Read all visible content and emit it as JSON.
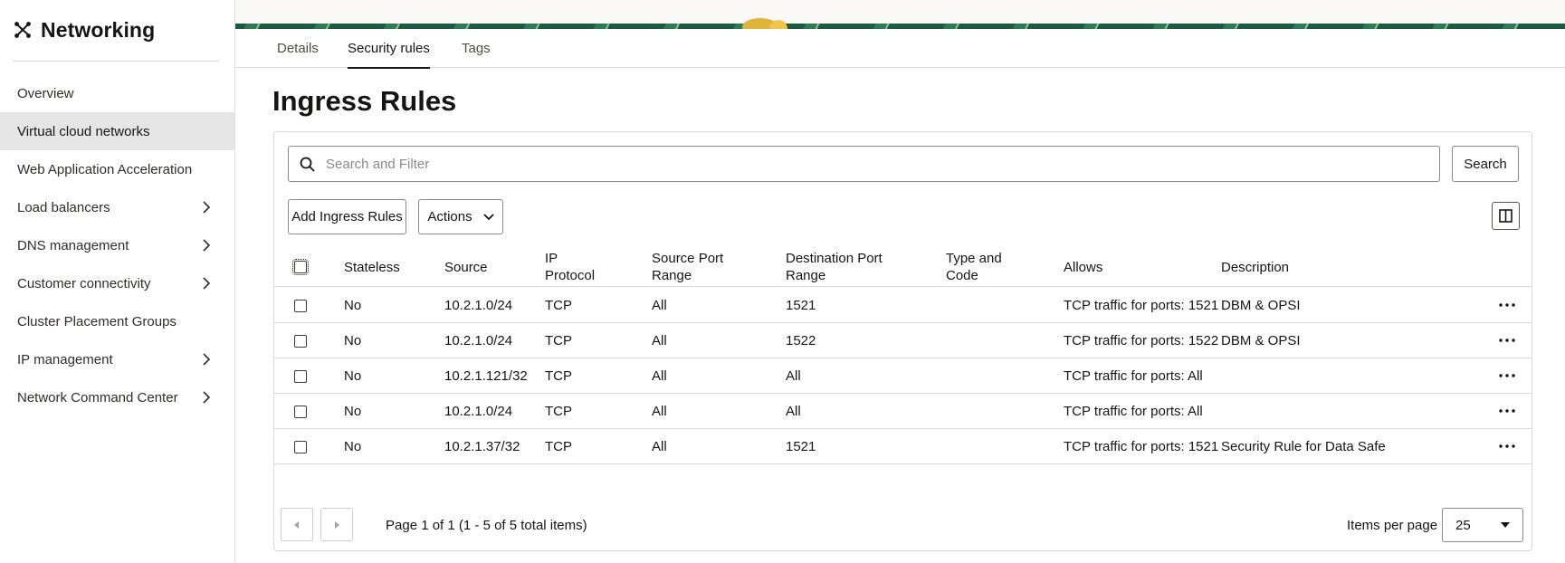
{
  "sidebar": {
    "title": "Networking",
    "items": [
      {
        "label": "Overview",
        "has_submenu": false,
        "active": false
      },
      {
        "label": "Virtual cloud networks",
        "has_submenu": false,
        "active": true
      },
      {
        "label": "Web Application Acceleration",
        "has_submenu": false,
        "active": false
      },
      {
        "label": "Load balancers",
        "has_submenu": true,
        "active": false
      },
      {
        "label": "DNS management",
        "has_submenu": true,
        "active": false
      },
      {
        "label": "Customer connectivity",
        "has_submenu": true,
        "active": false
      },
      {
        "label": "Cluster Placement Groups",
        "has_submenu": false,
        "active": false
      },
      {
        "label": "IP management",
        "has_submenu": true,
        "active": false
      },
      {
        "label": "Network Command Center",
        "has_submenu": true,
        "active": false
      }
    ]
  },
  "tabs": [
    {
      "label": "Details",
      "active": false
    },
    {
      "label": "Security rules",
      "active": true
    },
    {
      "label": "Tags",
      "active": false
    }
  ],
  "page_title": "Ingress Rules",
  "search": {
    "placeholder": "Search and Filter",
    "value": "",
    "button_label": "Search"
  },
  "toolbar": {
    "add_label": "Add Ingress Rules",
    "actions_label": "Actions"
  },
  "table": {
    "columns": [
      "Stateless",
      "Source",
      "IP Protocol",
      "Source Port Range",
      "Destination Port Range",
      "Type and Code",
      "Allows",
      "Description"
    ],
    "header_lines": [
      [
        "Stateless"
      ],
      [
        "Source"
      ],
      [
        "IP",
        "Protocol"
      ],
      [
        "Source Port",
        "Range"
      ],
      [
        "Destination Port",
        "Range"
      ],
      [
        "Type and",
        "Code"
      ],
      [
        "Allows"
      ],
      [
        "Description"
      ]
    ],
    "rows": [
      {
        "stateless": "No",
        "source": "10.2.1.0/24",
        "protocol": "TCP",
        "src_port": "All",
        "dst_port": "1521",
        "type_code": "",
        "allows": "TCP traffic for ports: 1521",
        "description": "DBM & OPSI"
      },
      {
        "stateless": "No",
        "source": "10.2.1.0/24",
        "protocol": "TCP",
        "src_port": "All",
        "dst_port": "1522",
        "type_code": "",
        "allows": "TCP traffic for ports: 1522",
        "description": "DBM & OPSI"
      },
      {
        "stateless": "No",
        "source": "10.2.1.121/32",
        "protocol": "TCP",
        "src_port": "All",
        "dst_port": "All",
        "type_code": "",
        "allows": "TCP traffic for ports: All",
        "description": ""
      },
      {
        "stateless": "No",
        "source": "10.2.1.0/24",
        "protocol": "TCP",
        "src_port": "All",
        "dst_port": "All",
        "type_code": "",
        "allows": "TCP traffic for ports: All",
        "description": ""
      },
      {
        "stateless": "No",
        "source": "10.2.1.37/32",
        "protocol": "TCP",
        "src_port": "All",
        "dst_port": "1521",
        "type_code": "",
        "allows": "TCP traffic for ports: 1521",
        "description": "Security Rule for Data Safe"
      }
    ]
  },
  "pagination": {
    "summary": "Page 1 of 1 (1 - 5 of 5 total items)",
    "items_per_page_label": "Items per page",
    "items_per_page": "25"
  },
  "icons": {
    "brand": "network-icon",
    "search": "search-icon",
    "chevron": "chevron-right-icon",
    "actions": "chevron-down-icon",
    "columns": "column-toggle-icon",
    "row_menu": "more-horizontal-icon",
    "prev": "caret-left-icon",
    "next": "caret-right-icon",
    "select": "caret-down-icon"
  },
  "colors": {
    "active_nav_bg": "#e5e5e5",
    "text": "#161513",
    "border": "#dcd9d5",
    "banner_green": "#1c5a43",
    "banner_accent": "#e0b339"
  }
}
